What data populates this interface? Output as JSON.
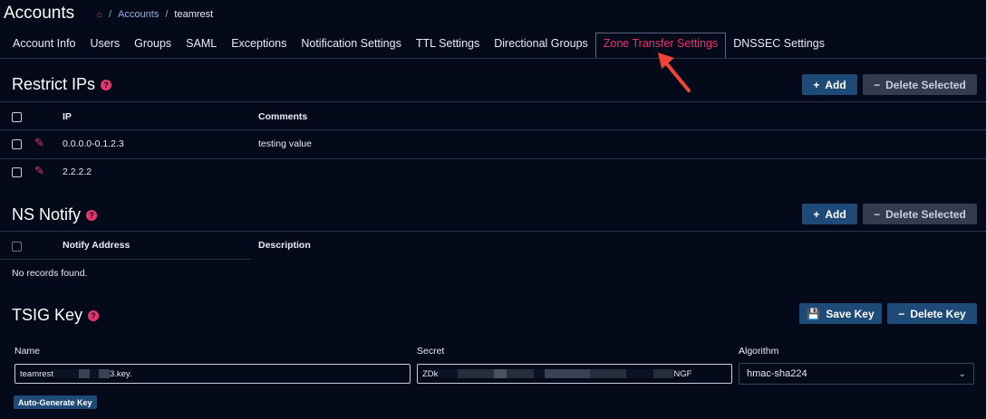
{
  "header": {
    "title": "Accounts",
    "breadcrumb": {
      "home_icon": "home-icon",
      "sep": "/",
      "link": "Accounts",
      "current": "teamrest"
    }
  },
  "tabs": [
    {
      "label": "Account Info",
      "active": false
    },
    {
      "label": "Users",
      "active": false
    },
    {
      "label": "Groups",
      "active": false
    },
    {
      "label": "SAML",
      "active": false
    },
    {
      "label": "Exceptions",
      "active": false
    },
    {
      "label": "Notification Settings",
      "active": false
    },
    {
      "label": "TTL Settings",
      "active": false
    },
    {
      "label": "Directional Groups",
      "active": false
    },
    {
      "label": "Zone Transfer Settings",
      "active": true
    },
    {
      "label": "DNSSEC Settings",
      "active": false
    }
  ],
  "restrict_ips": {
    "title": "Restrict IPs",
    "add_label": "Add",
    "delete_label": "Delete Selected",
    "columns": {
      "ip": "IP",
      "comments": "Comments"
    },
    "rows": [
      {
        "ip": "0.0.0.0-0.1.2.3",
        "comment": "testing value"
      },
      {
        "ip": "2.2.2.2",
        "comment": ""
      }
    ]
  },
  "ns_notify": {
    "title": "NS Notify",
    "add_label": "Add",
    "delete_label": "Delete Selected",
    "columns": {
      "address": "Notify Address",
      "description": "Description"
    },
    "empty_text": "No records found."
  },
  "tsig": {
    "title": "TSIG Key",
    "save_label": "Save Key",
    "delete_label": "Delete Key",
    "name_label": "Name",
    "name_prefix": "teamrest",
    "name_suffix": "3.key.",
    "secret_label": "Secret",
    "secret_prefix": "ZDk",
    "secret_suffix": "NGF",
    "algorithm_label": "Algorithm",
    "algorithm_value": "hmac-sha224",
    "autogen_label": "Auto-Generate Key"
  },
  "colors": {
    "accent": "#e8356f",
    "primary_button": "#1e4a78",
    "secondary_button": "#323c4e",
    "background": "#050a1a",
    "annotation_arrow": "#f04438"
  }
}
